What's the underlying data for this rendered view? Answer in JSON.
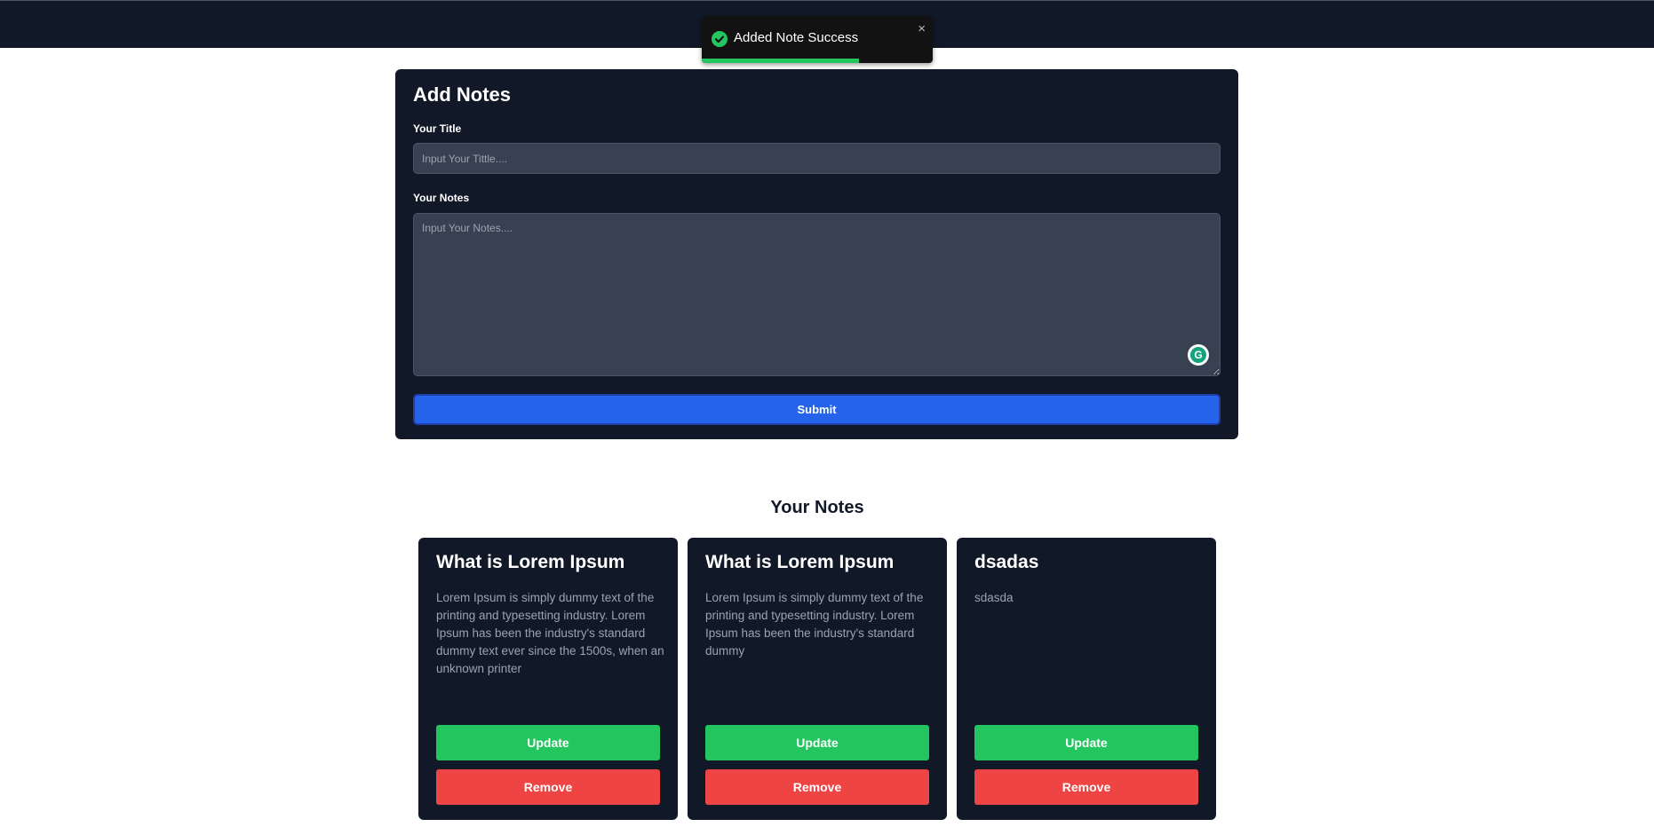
{
  "toast": {
    "message": "Added Note Success",
    "close_label": "×",
    "progress_fraction": 0.68,
    "icon": "check-circle-icon",
    "accent_color": "#22c55e"
  },
  "form": {
    "heading": "Add Notes",
    "title_label": "Your Title",
    "title_placeholder": "Input Your Tittle....",
    "title_value": "",
    "notes_label": "Your Notes",
    "notes_placeholder": "Input Your Notes....",
    "notes_value": "",
    "grammarly_icon": "grammarly-icon",
    "grammarly_letter": "G",
    "submit_label": "Submit"
  },
  "notes_section": {
    "heading": "Your Notes",
    "cards": [
      {
        "title": "What is Lorem Ipsum",
        "body": "Lorem Ipsum is simply dummy text of the printing and typesetting industry. Lorem Ipsum has been the industry's standard dummy text ever since the 1500s, when an unknown printer",
        "update_label": "Update",
        "remove_label": "Remove"
      },
      {
        "title": "What is Lorem Ipsum",
        "body": "Lorem Ipsum is simply dummy text of the printing and typesetting industry. Lorem Ipsum has been the industry's standard dummy",
        "update_label": "Update",
        "remove_label": "Remove"
      },
      {
        "title": "dsadas",
        "body": "sdasda",
        "update_label": "Update",
        "remove_label": "Remove"
      }
    ]
  },
  "colors": {
    "navbar": "#111827",
    "card": "#111827",
    "input": "#374151",
    "submit": "#2563eb",
    "update": "#22c55e",
    "remove": "#ef4444"
  }
}
